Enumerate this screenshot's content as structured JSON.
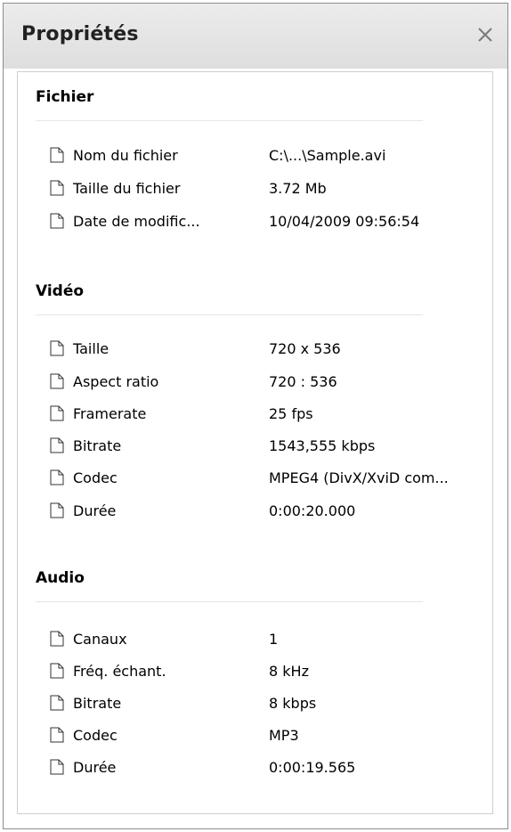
{
  "window": {
    "title": "Propriétés"
  },
  "sections": {
    "fichier": {
      "title": "Fichier",
      "rows": [
        {
          "label": "Nom du fichier",
          "value": "C:\\...\\Sample.avi"
        },
        {
          "label": "Taille du fichier",
          "value": "3.72 Mb"
        },
        {
          "label": "Date de modific...",
          "value": "10/04/2009 09:56:54"
        }
      ]
    },
    "video": {
      "title": "Vidéo",
      "rows": [
        {
          "label": "Taille",
          "value": "720 x 536"
        },
        {
          "label": "Aspect ratio",
          "value": "720 : 536"
        },
        {
          "label": "Framerate",
          "value": "25 fps"
        },
        {
          "label": "Bitrate",
          "value": "1543,555 kbps"
        },
        {
          "label": "Codec",
          "value": "MPEG4 (DivX/XviD com..."
        },
        {
          "label": "Durée",
          "value": "0:00:20.000"
        }
      ]
    },
    "audio": {
      "title": "Audio",
      "rows": [
        {
          "label": "Canaux",
          "value": "1"
        },
        {
          "label": "Fréq. échant.",
          "value": "8 kHz"
        },
        {
          "label": "Bitrate",
          "value": "8 kbps"
        },
        {
          "label": "Codec",
          "value": "MP3"
        },
        {
          "label": "Durée",
          "value": "0:00:19.565"
        }
      ]
    }
  },
  "icons": {
    "row_icon": "document-icon",
    "close": "close-icon"
  }
}
